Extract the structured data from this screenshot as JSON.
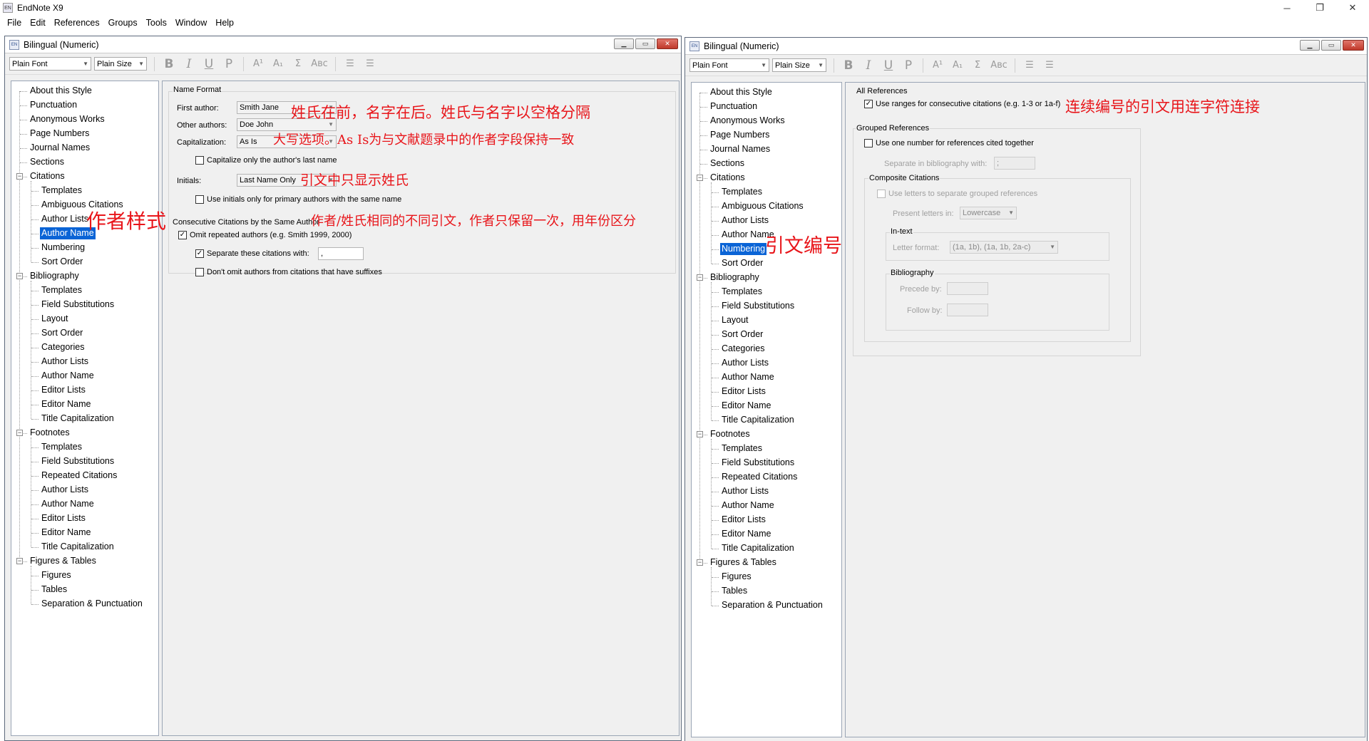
{
  "app": {
    "title": "EndNote X9",
    "logo_text": "EN",
    "window_controls": {
      "minimize": "─",
      "restore": "❐",
      "close": "✕"
    }
  },
  "menu": [
    "File",
    "Edit",
    "References",
    "Groups",
    "Tools",
    "Window",
    "Help"
  ],
  "left_window": {
    "title": "Bilingual (Numeric)",
    "logo_text": "EN",
    "font_combo": "Plain Font",
    "size_combo": "Plain Size",
    "toolbar_icons": [
      "bold-icon",
      "italic-icon",
      "underline-icon",
      "plain-icon",
      "superscript-icon",
      "subscript-icon",
      "symbol-icon",
      "small-caps-icon",
      "align-left-icon",
      "justify-icon"
    ],
    "toolbar_glyphs": [
      "B",
      "I",
      "U",
      "P",
      "A¹",
      "A₁",
      "Σ",
      "Aʙᴄ",
      "☰",
      "☰"
    ],
    "tree": [
      {
        "label": "About this Style",
        "level": 0
      },
      {
        "label": "Punctuation",
        "level": 0
      },
      {
        "label": "Anonymous Works",
        "level": 0
      },
      {
        "label": "Page Numbers",
        "level": 0
      },
      {
        "label": "Journal Names",
        "level": 0
      },
      {
        "label": "Sections",
        "level": 0
      },
      {
        "label": "Citations",
        "level": 0,
        "group": true
      },
      {
        "label": "Templates",
        "level": 1
      },
      {
        "label": "Ambiguous Citations",
        "level": 1
      },
      {
        "label": "Author Lists",
        "level": 1
      },
      {
        "label": "Author Name",
        "level": 1,
        "selected": true
      },
      {
        "label": "Numbering",
        "level": 1
      },
      {
        "label": "Sort Order",
        "level": 1
      },
      {
        "label": "Bibliography",
        "level": 0,
        "group": true
      },
      {
        "label": "Templates",
        "level": 1
      },
      {
        "label": "Field Substitutions",
        "level": 1
      },
      {
        "label": "Layout",
        "level": 1
      },
      {
        "label": "Sort Order",
        "level": 1
      },
      {
        "label": "Categories",
        "level": 1
      },
      {
        "label": "Author Lists",
        "level": 1
      },
      {
        "label": "Author Name",
        "level": 1
      },
      {
        "label": "Editor Lists",
        "level": 1
      },
      {
        "label": "Editor Name",
        "level": 1
      },
      {
        "label": "Title Capitalization",
        "level": 1
      },
      {
        "label": "Footnotes",
        "level": 0,
        "group": true
      },
      {
        "label": "Templates",
        "level": 1
      },
      {
        "label": "Field Substitutions",
        "level": 1
      },
      {
        "label": "Repeated Citations",
        "level": 1
      },
      {
        "label": "Author Lists",
        "level": 1
      },
      {
        "label": "Author Name",
        "level": 1
      },
      {
        "label": "Editor Lists",
        "level": 1
      },
      {
        "label": "Editor Name",
        "level": 1
      },
      {
        "label": "Title Capitalization",
        "level": 1
      },
      {
        "label": "Figures & Tables",
        "level": 0,
        "group": true
      },
      {
        "label": "Figures",
        "level": 1
      },
      {
        "label": "Tables",
        "level": 1
      },
      {
        "label": "Separation & Punctuation",
        "level": 1
      }
    ],
    "panel": {
      "name_format_label": "Name Format",
      "first_author_label": "First author:",
      "first_author_value": "Smith Jane",
      "other_authors_label": "Other authors:",
      "other_authors_value": "Doe John",
      "capitalization_label": "Capitalization:",
      "capitalization_value": "As Is",
      "cap_last_name_label": "Capitalize only the author's last name",
      "initials_label": "Initials:",
      "initials_value": "Last Name Only",
      "use_initials_label": "Use initials only for primary authors with the same name",
      "consecutive_label": "Consecutive Citations by the Same Author",
      "omit_repeated_label": "Omit repeated authors (e.g. Smith 1999, 2000)",
      "separate_label": "Separate these citations with:",
      "separate_value": ",",
      "dont_omit_label": "Don't omit authors from citations that have suffixes"
    },
    "annotations": {
      "author_style": "作者样式",
      "name_order": "姓氏在前，名字在后。姓氏与名字以空格分隔",
      "capitalization": "大写选项。As Is为与文献题录中的作者字段保持一致",
      "initials": "引文中只显示姓氏",
      "consecutive": "作者/姓氏相同的不同引文，作者只保留一次，用年份区分"
    }
  },
  "right_window": {
    "title": "Bilingual (Numeric)",
    "logo_text": "EN",
    "font_combo": "Plain Font",
    "size_combo": "Plain Size",
    "tree_selected": "Numbering",
    "panel": {
      "all_references_label": "All References",
      "use_ranges_label": "Use ranges for consecutive citations (e.g. 1-3 or 1a-f)",
      "grouped_label": "Grouped References",
      "one_number_label": "Use one number for references cited together",
      "separate_in_bib_label": "Separate in bibliography with:",
      "separate_in_bib_value": ";",
      "composite_label": "Composite Citations",
      "use_letters_label": "Use letters to separate grouped references",
      "present_letters_label": "Present letters in:",
      "present_letters_value": "Lowercase",
      "in_text_label": "In-text",
      "letter_format_label": "Letter format:",
      "letter_format_value": "(1a, 1b), (1a, 1b, 2a-c)",
      "bibliography_label": "Bibliography",
      "precede_label": "Precede by:",
      "follow_label": "Follow by:"
    },
    "annotations": {
      "ranges": "连续编号的引文用连字符连接",
      "numbering": "引文编号"
    }
  },
  "colors": {
    "selection": "#0a64d6",
    "annotation": "#e8151a",
    "close_button": "#c0392b"
  }
}
